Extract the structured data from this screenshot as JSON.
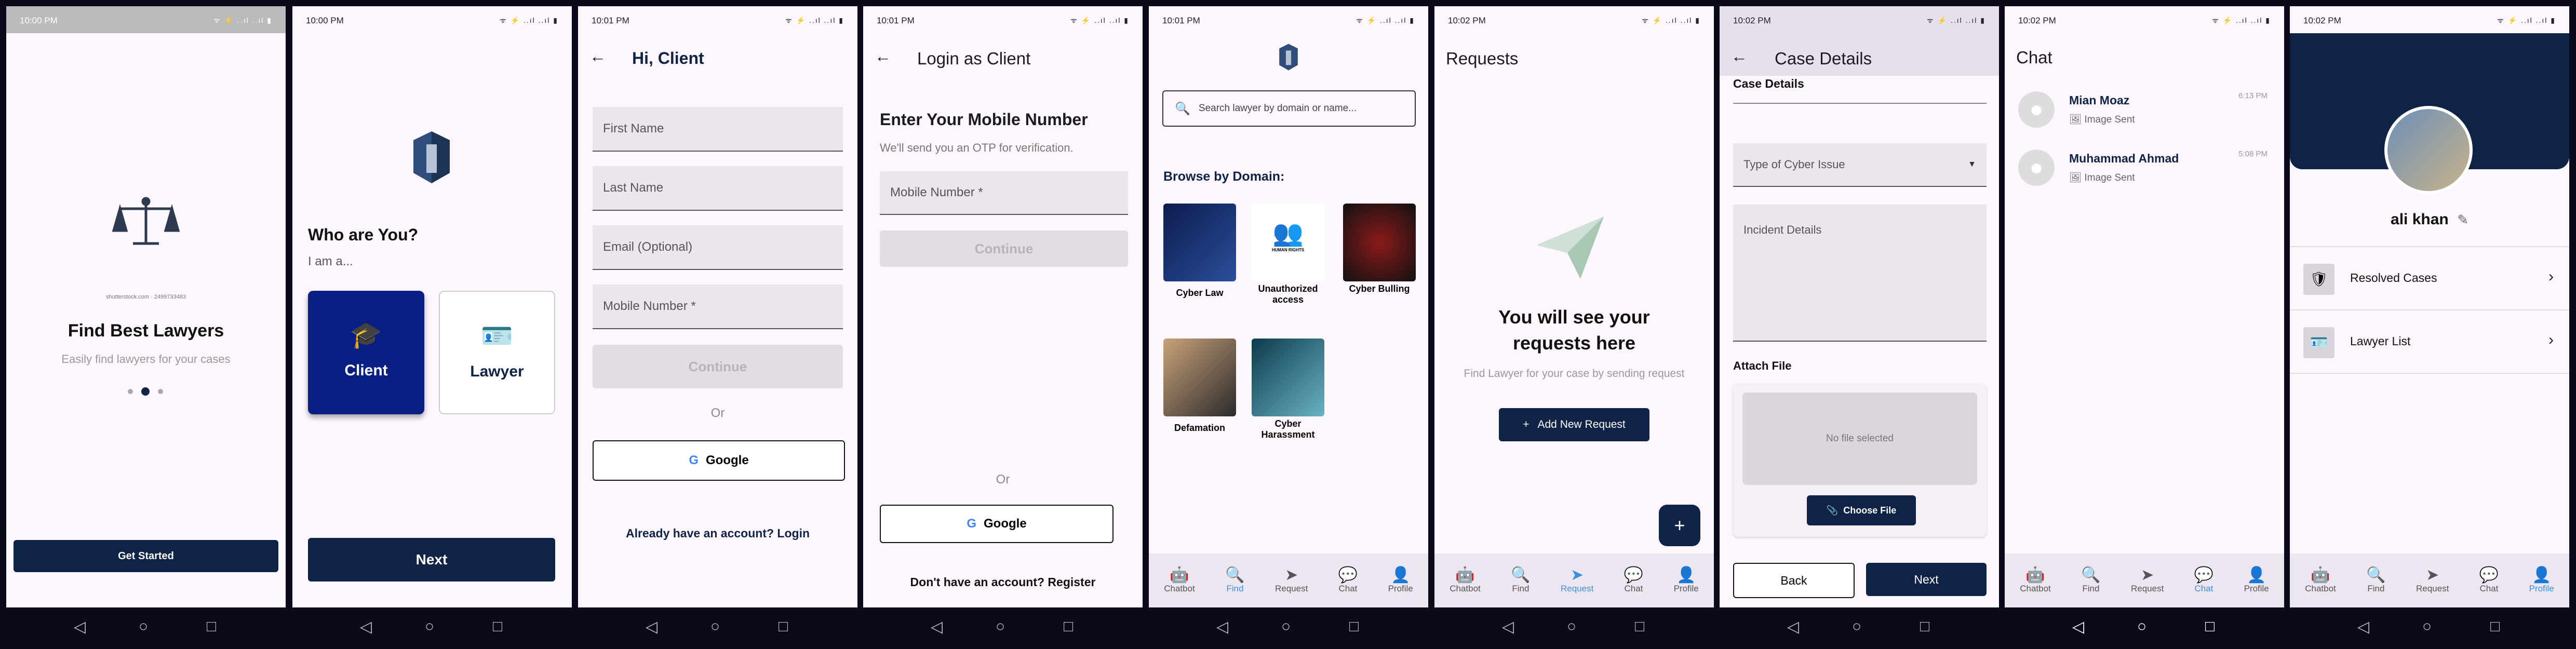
{
  "status": {
    "s1": "10:00 PM",
    "s2": "10:00 PM",
    "s3": "10:01 PM",
    "s4": "10:01 PM",
    "s5": "10:01 PM",
    "s6": "10:02 PM",
    "s7": "10:02 PM",
    "s8": "10:02 PM",
    "s9": "10:02 PM",
    "icons": "ᯤ ⚡ ..ıl ..ıl ▮"
  },
  "onboarding": {
    "credit": "shutterstock.com · 2499733483",
    "headline": "Find Best Lawyers",
    "subline": "Easily find lawyers for your cases",
    "get_started": "Get Started"
  },
  "role": {
    "question": "Who are You?",
    "prompt": "I am a...",
    "client": "Client",
    "lawyer": "Lawyer",
    "next": "Next"
  },
  "signup": {
    "title": "Hi, Client",
    "first_name": "First Name",
    "last_name": "Last Name",
    "email": "Email (Optional)",
    "mobile": "Mobile Number *",
    "continue": "Continue",
    "or": "Or",
    "google": "Google",
    "login_link": "Already have an account? Login"
  },
  "login": {
    "title": "Login as Client",
    "heading": "Enter Your Mobile Number",
    "hint": "We'll send you an OTP for verification.",
    "mobile": "Mobile Number *",
    "continue": "Continue",
    "or": "Or",
    "google": "Google",
    "register_link": "Don't have an account? Register"
  },
  "find": {
    "search_placeholder": "Search lawyer by domain or name...",
    "browse_title": "Browse by Domain:",
    "domains": [
      "Cyber Law",
      "Unauthorized access",
      "Cyber Bulling",
      "Defamation",
      "Cyber Harassment"
    ],
    "domain_tile_text": "HUMAN RIGHTS"
  },
  "requests": {
    "title": "Requests",
    "empty_title": "You will see your requests here",
    "empty_sub": "Find Lawyer for your case by sending request",
    "add_button": "Add New Request",
    "fab": "+"
  },
  "case": {
    "title": "Case Details",
    "section": "Case Details",
    "type_label": "Type of Cyber Issue",
    "incident_label": "Incident Details",
    "attach_label": "Attach File",
    "no_file": "No file selected",
    "choose_file": "Choose File",
    "back": "Back",
    "next": "Next"
  },
  "chat": {
    "title": "Chat",
    "items": [
      {
        "name": "Mian Moaz",
        "preview": "Image Sent",
        "time": "6:13 PM"
      },
      {
        "name": "Muhammad Ahmad",
        "preview": "Image Sent",
        "time": "5:08 PM"
      }
    ]
  },
  "profile": {
    "name": "ali khan",
    "items": [
      "Resolved Cases",
      "Lawyer List"
    ]
  },
  "nav": [
    "Chatbot",
    "Find",
    "Request",
    "Chat",
    "Profile"
  ],
  "colors": {
    "navy": "#0f2346",
    "active": "#3d8fe0",
    "background": "#fdf7fd"
  }
}
